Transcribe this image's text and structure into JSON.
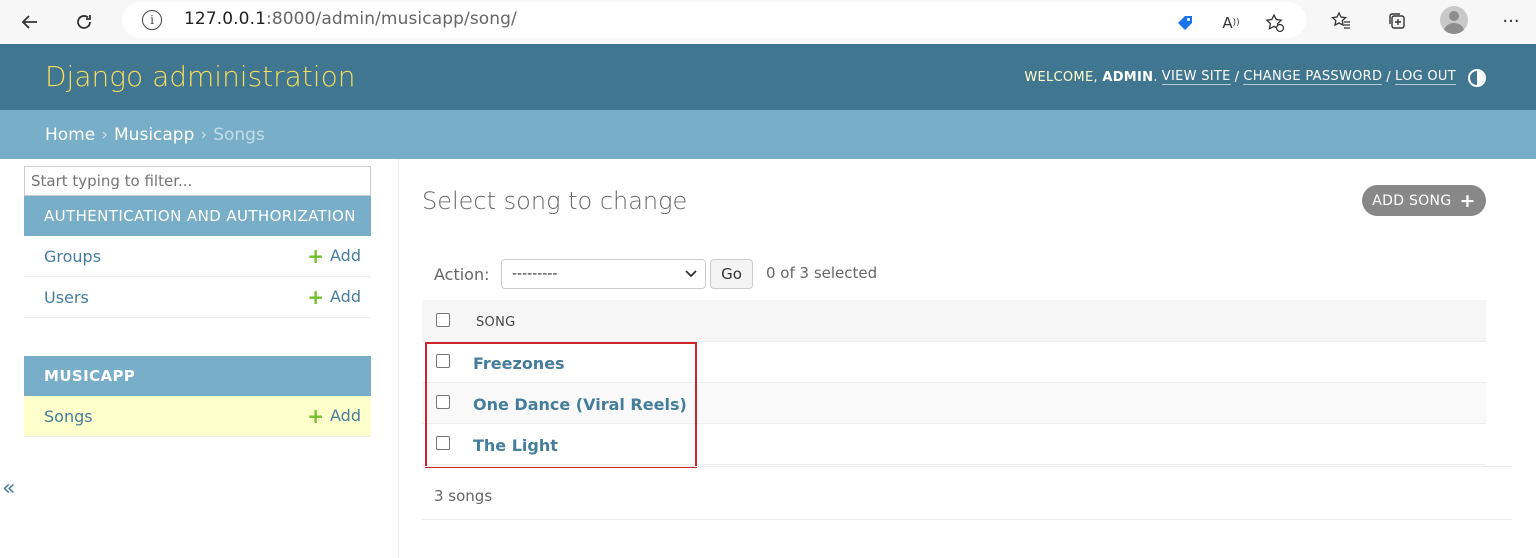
{
  "browser": {
    "url_host": "127.0.0.1",
    "url_rest": ":8000/admin/musicapp/song/"
  },
  "header": {
    "branding": "Django administration",
    "welcome": "WELCOME,",
    "user": "ADMIN",
    "view_site": "VIEW SITE",
    "change_password": "CHANGE PASSWORD",
    "log_out": "LOG OUT"
  },
  "breadcrumbs": {
    "home": "Home",
    "app": "Musicapp",
    "current": "Songs"
  },
  "sidebar": {
    "filter_placeholder": "Start typing to filter...",
    "apps": [
      {
        "caption": "AUTHENTICATION AND AUTHORIZATION",
        "models": [
          {
            "name": "Groups",
            "add": "Add"
          },
          {
            "name": "Users",
            "add": "Add"
          }
        ]
      },
      {
        "caption": "MUSICAPP",
        "models": [
          {
            "name": "Songs",
            "add": "Add"
          }
        ]
      }
    ]
  },
  "content": {
    "title": "Select song to change",
    "add_button": "ADD SONG",
    "action_label": "Action:",
    "action_selected": "---------",
    "go": "Go",
    "counter": "0 of 3 selected",
    "column_header": "SONG",
    "songs": [
      "Freezones",
      "One Dance (Viral Reels)",
      "The Light"
    ],
    "paginator": "3 songs"
  },
  "colors": {
    "header_bg": "#417690",
    "breadcrumbs_bg": "#79aec8",
    "branding": "#f5dd5d",
    "link": "#447e9b",
    "add_plus": "#70bf2b",
    "highlight_box": "#d0242b"
  }
}
